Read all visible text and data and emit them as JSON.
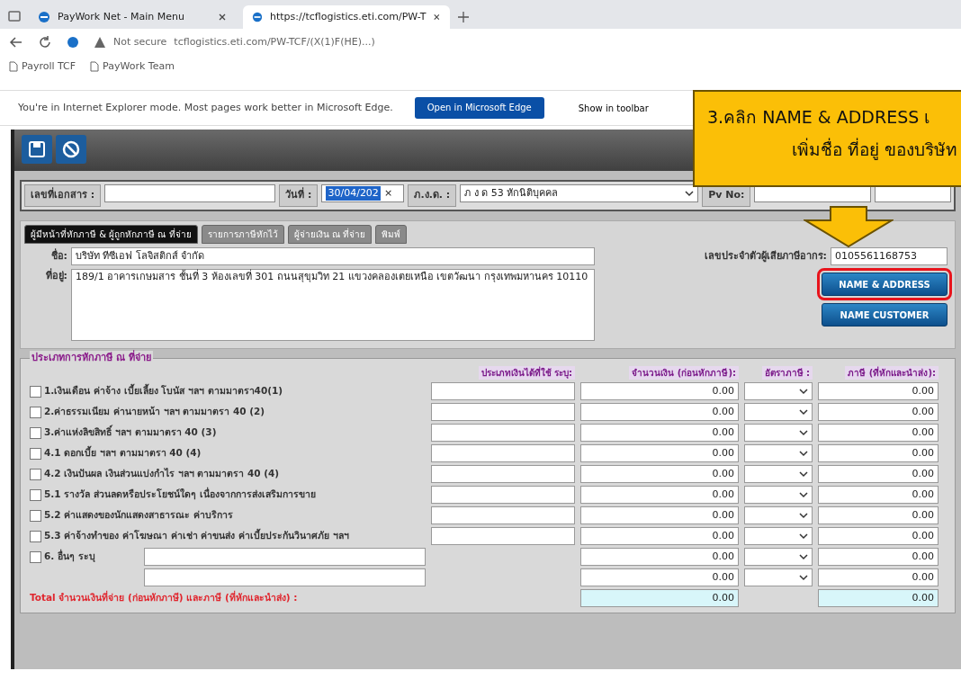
{
  "browser": {
    "tabs": [
      {
        "title": "PayWork Net - Main Menu",
        "selected": false
      },
      {
        "title": "https://tcflogistics.eti.com/PW-T",
        "selected": true
      }
    ],
    "address": {
      "security": "Not secure",
      "url": "tcflogistics.eti.com/PW-TCF/(X(1)F(HE)...)"
    },
    "bookmarks": [
      "Payroll TCF",
      "PayWork Team"
    ],
    "ie_bar": {
      "message": "You're in Internet Explorer mode. Most pages work better in Microsoft Edge.",
      "buttons": [
        "Open in Microsoft Edge",
        "Show in toolbar"
      ]
    }
  },
  "app": {
    "header_fields": [
      {
        "kind": "input",
        "label": "เลขที่เอกสาร :"
      },
      {
        "kind": "date",
        "label": "วันที่ :",
        "value": "30/04/202",
        "clear": "×"
      },
      {
        "kind": "select",
        "label": "ภ.ง.ด. :",
        "value": "ภ ง ด 53 หักนิติบุคคล"
      },
      {
        "kind": "input",
        "label": "Pv No:"
      }
    ],
    "tabs": [
      {
        "label": "ผู้มีหน้าที่หักภาษี & ผู้ถูกหักภาษี ณ ที่จ่าย",
        "selected": true
      },
      {
        "label": "รายการภาษีหักไว้",
        "selected": false
      },
      {
        "label": "ผู้จ่ายเงิน ณ ที่จ่าย",
        "selected": false
      },
      {
        "label": "พิมพ์",
        "selected": false
      }
    ],
    "name": {
      "label": "ชื่อ:",
      "value": "บริษัท ทีซีเอฟ โลจิสติกส์ จำกัด"
    },
    "address": {
      "label": "ที่อยู่:",
      "value": "189/1 อาคารเกษมสาร ชั้นที่ 3 ห้องเลขที่ 301 ถนนสุขุมวิท 21 แขวงคลองเตยเหนือ เขตวัฒนา กรุงเทพมหานคร 10110"
    },
    "tax_id": {
      "label": "เลขประจำตัวผู้เสียภาษีอากร:",
      "value": "0105561168753"
    },
    "buttons": [
      {
        "label": "NAME & ADDRESS",
        "highlighted": true
      },
      {
        "label": "NAME CUSTOMER",
        "highlighted": false
      }
    ],
    "income": {
      "legend": "ประเภทการหักภาษี ณ ที่จ่าย",
      "columns": [
        "ประเภทเงินได้ที่ใช้ ระบุ:",
        "จำนวนเงิน (ก่อนหักภาษี):",
        "อัตราภาษี :",
        "ภาษี (ที่หักและนำส่ง):"
      ],
      "rows": [
        {
          "kind": "standard",
          "label": "1.เงินเดือน ค่าจ้าง เบี้ยเลี้ยง โบนัส ฯลฯ ตามมาตรา40(1)",
          "checked": false,
          "amount": "0.00",
          "tax": "0.00"
        },
        {
          "kind": "standard",
          "label": "2.ค่าธรรมเนียม ค่านายหน้า ฯลฯ ตามมาตรา 40 (2)",
          "checked": false,
          "amount": "0.00",
          "tax": "0.00"
        },
        {
          "kind": "standard",
          "label": "3.ค่าแห่งลิขสิทธิ์ ฯลฯ ตามมาตรา 40 (3)",
          "checked": false,
          "amount": "0.00",
          "tax": "0.00"
        },
        {
          "kind": "standard",
          "label": "4.1 ดอกเบี้ย ฯลฯ ตามมาตรา 40 (4)",
          "checked": false,
          "amount": "0.00",
          "tax": "0.00"
        },
        {
          "kind": "standard",
          "label": "4.2 เงินปันผล เงินส่วนแบ่งกำไร ฯลฯ ตามมาตรา 40 (4)",
          "checked": false,
          "amount": "0.00",
          "tax": "0.00"
        },
        {
          "kind": "standard",
          "label": "5.1 รางวัล ส่วนลดหรือประโยชน์ใดๆ เนื่องจากการส่งเสริมการขาย",
          "checked": false,
          "amount": "0.00",
          "tax": "0.00"
        },
        {
          "kind": "standard",
          "label": "5.2 ค่าแสดงของนักแสดงสาธารณะ ค่าบริการ",
          "checked": false,
          "amount": "0.00",
          "tax": "0.00"
        },
        {
          "kind": "standard",
          "label": "5.3 ค่าจ้างทำของ ค่าโฆษณา ค่าเช่า ค่าขนส่ง ค่าเบี้ยประกันวินาศภัย ฯลฯ",
          "checked": false,
          "amount": "0.00",
          "tax": "0.00"
        },
        {
          "kind": "other",
          "label": "6. อื่นๆ ระบุ",
          "checked": false,
          "lines": [
            {
              "amount": "0.00",
              "tax": "0.00"
            },
            {
              "amount": "0.00",
              "tax": "0.00"
            }
          ]
        }
      ],
      "total": {
        "label": "Total จำนวนเงินที่จ่าย (ก่อนหักภาษี) และภาษี (ที่หักและนำส่ง) :",
        "amount": "0.00",
        "tax": "0.00"
      }
    }
  },
  "callout": {
    "lines": [
      "3.คลิก NAME & ADDRESS เ",
      "เพิ่มชื่อ ที่อยู่ ของบริษัท"
    ]
  }
}
